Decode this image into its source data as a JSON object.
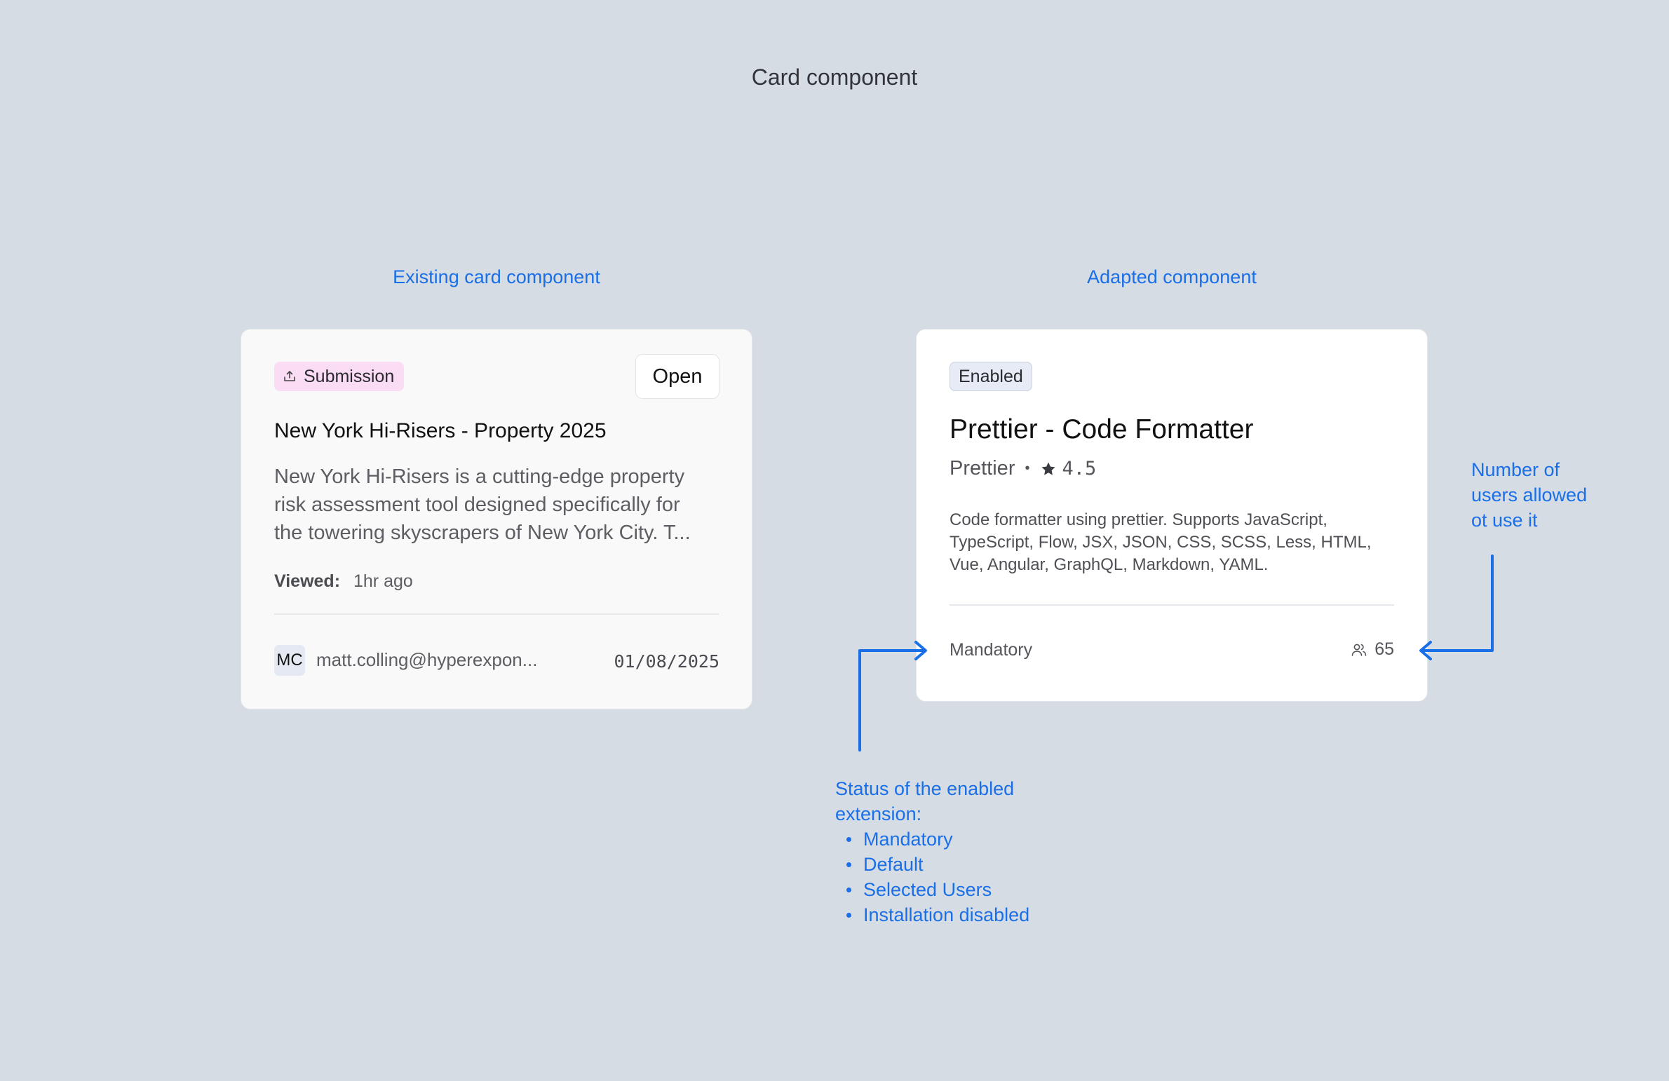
{
  "page": {
    "title": "Card component"
  },
  "sections": {
    "existing_label": "Existing card component",
    "adapted_label": "Adapted component"
  },
  "existing_card": {
    "tag": {
      "label": "Submission",
      "icon": "upload-tray-icon",
      "color": "#fbdcf5"
    },
    "open_button": "Open",
    "title": "New York Hi-Risers - Property 2025",
    "description_lines": [
      "New York Hi-Risers is a cutting-edge property",
      "risk assessment tool designed specifically for",
      "the towering skyscrapers of New York City. T..."
    ],
    "viewed": {
      "label": "Viewed:",
      "value": "1hr ago"
    },
    "owner": {
      "initials": "MC",
      "email": "matt.colling@hyperexpon..."
    },
    "date": "01/08/2025"
  },
  "adapted_card": {
    "tag": {
      "label": "Enabled"
    },
    "title": "Prettier - Code Formatter",
    "publisher": "Prettier",
    "separator": "•",
    "rating": "4.5",
    "rating_icon": "star-icon",
    "description": "Code formatter using prettier. Supports JavaScript, TypeScript, Flow, JSX, JSON, CSS, SCSS, Less, HTML, Vue, Angular, GraphQL, Markdown, YAML.",
    "status": "Mandatory",
    "users": {
      "icon": "users-icon",
      "count": "65"
    }
  },
  "annotations": {
    "users_note": [
      "Number of",
      "users allowed",
      "ot use it"
    ],
    "status_note": {
      "heading_lines": [
        "Status of the enabled",
        "extension:"
      ],
      "items": [
        "Mandatory",
        "Default",
        "Selected Users",
        "Installation disabled"
      ]
    }
  },
  "colors": {
    "background": "#d6dce4",
    "annotation_blue": "#1a6fe8"
  }
}
